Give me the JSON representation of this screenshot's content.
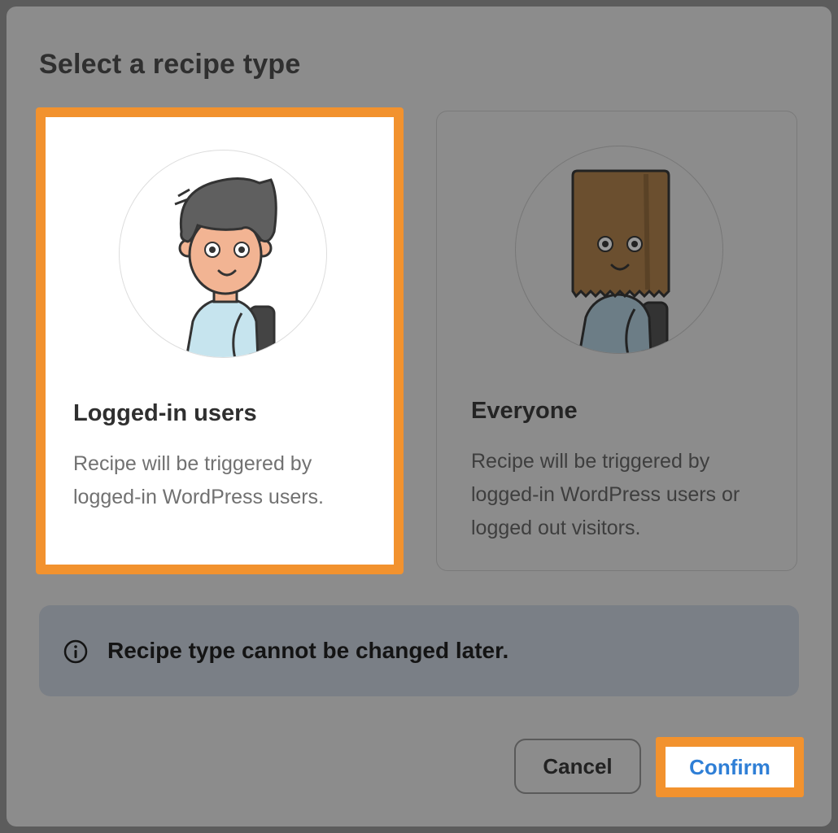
{
  "dialog": {
    "title": "Select a recipe type"
  },
  "options": [
    {
      "title": "Logged-in users",
      "description": "Recipe will be triggered by logged-in WordPress users.",
      "selected": true,
      "illustration": "user-avatar-icon"
    },
    {
      "title": "Everyone",
      "description": "Recipe will be triggered by logged-in WordPress users or logged out visitors.",
      "selected": false,
      "illustration": "paper-bag-avatar-icon"
    }
  ],
  "notice": {
    "icon": "info-icon",
    "text": "Recipe type cannot be changed later."
  },
  "buttons": {
    "cancel_label": "Cancel",
    "confirm_label": "Confirm"
  },
  "colors": {
    "highlight": "#f2922e",
    "confirm_text": "#2f7fd6",
    "overlay": "#8c8c8c"
  }
}
